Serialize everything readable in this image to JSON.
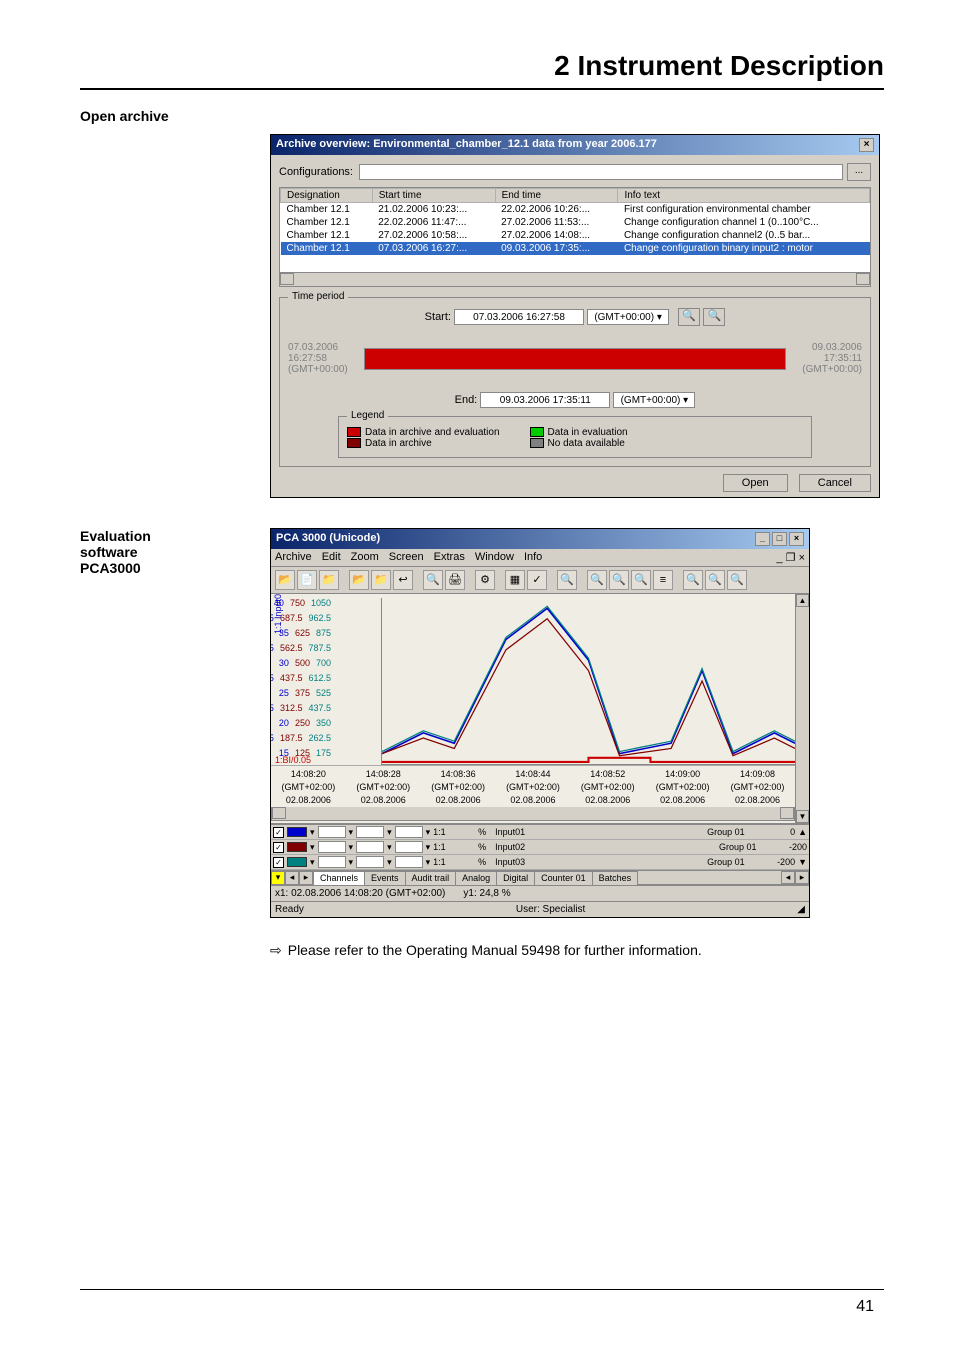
{
  "chapter_title": "2 Instrument Description",
  "section_open_archive": "Open archive",
  "archive_dialog": {
    "title": "Archive overview: Environmental_chamber_12.1 data from year 2006.177",
    "config_label": "Configurations:",
    "dots": "...",
    "cols": {
      "c1": "Designation",
      "c2": "Start time",
      "c3": "End time",
      "c4": "Info text"
    },
    "rows": [
      {
        "d": "Chamber 12.1",
        "s": "21.02.2006 10:23:...",
        "e": "22.02.2006 10:26:...",
        "i": "First configuration environmental chamber"
      },
      {
        "d": "Chamber 12.1",
        "s": "22.02.2006 11:47:...",
        "e": "27.02.2006 11:53:...",
        "i": "Change configuration channel 1 (0..100°C..."
      },
      {
        "d": "Chamber 12.1",
        "s": "27.02.2006 10:58:...",
        "e": "27.02.2006 14:08:...",
        "i": "Change configuration channel2 (0..5 bar..."
      },
      {
        "d": "Chamber 12.1",
        "s": "07.03.2006 16:27:...",
        "e": "09.03.2006 17:35:...",
        "i": "Change configuration binary input2 : motor"
      }
    ],
    "time_period_label": "Time period",
    "start_label": "Start:",
    "end_label": "End:",
    "start_val": "07.03.2006 16:27:58",
    "end_val": "09.03.2006 17:35:11",
    "gmt": "(GMT+00:00)",
    "range_l1": "07.03.2006",
    "range_l2": "16:27:58",
    "range_l3": "(GMT+00:00)",
    "range_r1": "09.03.2006",
    "range_r2": "17:35:11",
    "range_r3": "(GMT+00:00)",
    "legend_label": "Legend",
    "leg1": "Data in archive and evaluation",
    "leg2": "Data in archive",
    "leg3": "Data in evaluation",
    "leg4": "No data available",
    "open_btn": "Open",
    "cancel_btn": "Cancel"
  },
  "eval_label_l1": "Evaluation",
  "eval_label_l2": "software",
  "eval_label_l3": "PCA3000",
  "pca": {
    "title": "PCA 3000 (Unicode)",
    "menu": {
      "m1": "Archive",
      "m2": "Edit",
      "m3": "Zoom",
      "m4": "Screen",
      "m5": "Extras",
      "m6": "Window",
      "m7": "Info"
    },
    "yaxis_label": "1:1 Input01 %",
    "xticks": {
      "t1": "14:08:20",
      "t2": "14:08:28",
      "t3": "14:08:36",
      "t4": "14:08:44",
      "t5": "14:08:52",
      "t6": "14:09:00",
      "t7": "14:09:08",
      "g": "(GMT+02:00)",
      "d": "02.08.2006"
    },
    "bi_label": "1:BI/0.05",
    "ch": {
      "unit": "%",
      "in1": "Input01",
      "in2": "Input02",
      "in3": "Input03",
      "grp": "Group 01",
      "v1": "0",
      "v2": "-200",
      "v3": "-200"
    },
    "tabs": {
      "t1": "Channels",
      "t2": "Events",
      "t3": "Audit trail",
      "t4": "Analog",
      "t5": "Digital",
      "t6": "Counter 01",
      "t7": "Batches"
    },
    "status_x": "x1: 02.08.2006 14:08:20 (GMT+02:00)",
    "status_y": "y1: 24,8 %",
    "ready": "Ready",
    "user": "User: Specialist"
  },
  "note_text": "Please refer to the Operating Manual 59498 for further information.",
  "note_arrow": "⇨",
  "page_number": "41"
}
